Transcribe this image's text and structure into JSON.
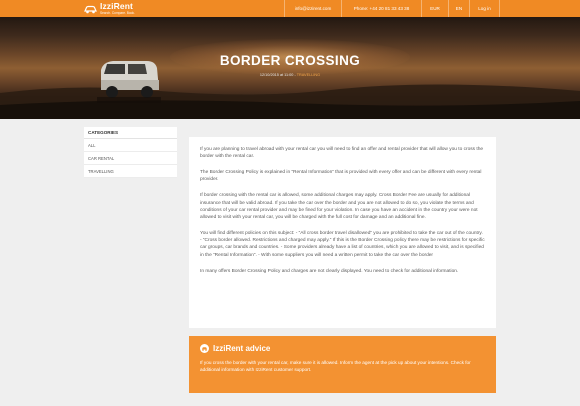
{
  "header": {
    "logo_name": "IzziRent",
    "logo_tagline": "Search. Compare. Book.",
    "email": "info@izzirent.com",
    "phone": "Phone: +44 20 81 33 43 38",
    "currency": "EUR",
    "language": "EN",
    "login": "Log in"
  },
  "hero": {
    "title": "BORDER CROSSING",
    "date": "12/10/2015 at 11:00 -",
    "tag": "TRAVELLING"
  },
  "sidebar": {
    "heading": "CATEGORIES",
    "items": [
      {
        "label": "ALL"
      },
      {
        "label": "CAR RENTAL"
      },
      {
        "label": "TRAVELLING"
      }
    ]
  },
  "article": {
    "paragraphs": [
      "If you are planning to travel abroad with your rental car you will need to find an offer and rental provider that will allow you to cross the border with the rental car.",
      "The Border Crossing Policy is explained in “Rental Information” that is provided with every offer and can be different with every rental provider.",
      "If border crossing with the rental car is allowed, some additional charges may apply. Cross Border Fee are usually for additional insurance that will be valid abroad. If you take the car over the border and you are not allowed to do so, you violate the terms and conditions of your car rental provider and may be fined for your violation. In case you have an accident in the country your were not allowed to visit with your rental car, you will be charged with the full cost for damage and an additional fine.",
      "You will find different policies on this subject: - “All cross border travel disallowed” you are prohibited to take the car out of the country. - “Cross border allowed. Restrictions and charged may apply.” If this is the Border Crossing policy there may be restrictions for specific car groups, car brands and countries. - Some providers already have a list of countries, which you are allowed to visit, and is specified in the “Rental Information”. - With some suppliers you will need a written permit to take the car over the border",
      "In many offers Border Crossing Policy and charges are not clearly displayed. You need to check for additional information."
    ]
  },
  "advice": {
    "title": "IzziRent advice",
    "text": "If you cross the border with your rental car, make sure it is allowed. Inform the agent at the pick up about your intentions. Check for additional information with IzziRent customer support."
  },
  "colors": {
    "accent": "#f08a24",
    "advice_bg": "#f39232",
    "page_bg": "#efefef"
  },
  "icons": {
    "logo": "car-logo-icon",
    "advice": "advice-logo-icon"
  }
}
